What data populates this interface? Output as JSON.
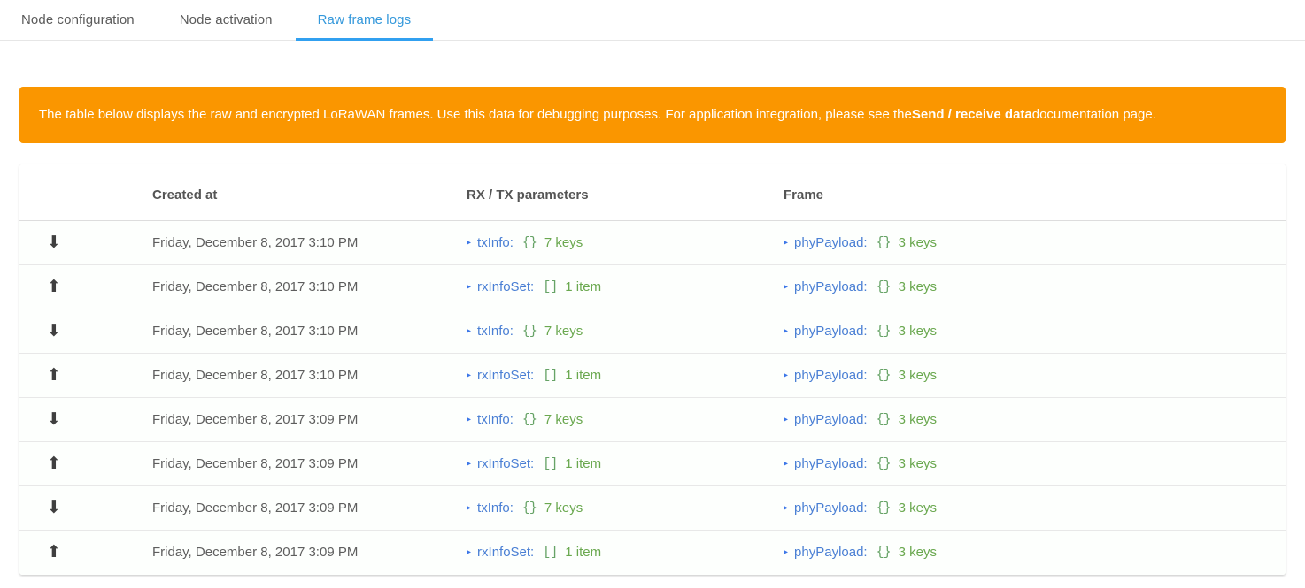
{
  "tabs": [
    {
      "label": "Node configuration",
      "active": false
    },
    {
      "label": "Node activation",
      "active": false
    },
    {
      "label": "Raw frame logs",
      "active": true
    }
  ],
  "alert": {
    "text_before": "The table below displays the raw and encrypted LoRaWAN frames. Use this data for debugging purposes. For application integration, please see the ",
    "link_label": "Send / receive data",
    "text_after": " documentation page.",
    "background": "#fa9600",
    "text_color": "#ffffff"
  },
  "table": {
    "columns": [
      {
        "key": "direction",
        "label": ""
      },
      {
        "key": "created_at",
        "label": "Created at"
      },
      {
        "key": "rxtx",
        "label": "RX / TX parameters"
      },
      {
        "key": "frame",
        "label": "Frame"
      }
    ],
    "rows": [
      {
        "direction_icon": "arrow-down-icon",
        "direction_glyph": "⬇",
        "created_at": "Friday, December 8, 2017 3:10 PM",
        "rxtx": {
          "caret": "▸",
          "key": "txInfo:",
          "brace": "{}",
          "count": "7 keys"
        },
        "frame": {
          "caret": "▸",
          "key": "phyPayload:",
          "brace": "{}",
          "count": "3 keys"
        }
      },
      {
        "direction_icon": "arrow-up-icon",
        "direction_glyph": "⬆",
        "created_at": "Friday, December 8, 2017 3:10 PM",
        "rxtx": {
          "caret": "▸",
          "key": "rxInfoSet:",
          "brace": "[]",
          "count": "1 item"
        },
        "frame": {
          "caret": "▸",
          "key": "phyPayload:",
          "brace": "{}",
          "count": "3 keys"
        }
      },
      {
        "direction_icon": "arrow-down-icon",
        "direction_glyph": "⬇",
        "created_at": "Friday, December 8, 2017 3:10 PM",
        "rxtx": {
          "caret": "▸",
          "key": "txInfo:",
          "brace": "{}",
          "count": "7 keys"
        },
        "frame": {
          "caret": "▸",
          "key": "phyPayload:",
          "brace": "{}",
          "count": "3 keys"
        }
      },
      {
        "direction_icon": "arrow-up-icon",
        "direction_glyph": "⬆",
        "created_at": "Friday, December 8, 2017 3:10 PM",
        "rxtx": {
          "caret": "▸",
          "key": "rxInfoSet:",
          "brace": "[]",
          "count": "1 item"
        },
        "frame": {
          "caret": "▸",
          "key": "phyPayload:",
          "brace": "{}",
          "count": "3 keys"
        }
      },
      {
        "direction_icon": "arrow-down-icon",
        "direction_glyph": "⬇",
        "created_at": "Friday, December 8, 2017 3:09 PM",
        "rxtx": {
          "caret": "▸",
          "key": "txInfo:",
          "brace": "{}",
          "count": "7 keys"
        },
        "frame": {
          "caret": "▸",
          "key": "phyPayload:",
          "brace": "{}",
          "count": "3 keys"
        }
      },
      {
        "direction_icon": "arrow-up-icon",
        "direction_glyph": "⬆",
        "created_at": "Friday, December 8, 2017 3:09 PM",
        "rxtx": {
          "caret": "▸",
          "key": "rxInfoSet:",
          "brace": "[]",
          "count": "1 item"
        },
        "frame": {
          "caret": "▸",
          "key": "phyPayload:",
          "brace": "{}",
          "count": "3 keys"
        }
      },
      {
        "direction_icon": "arrow-down-icon",
        "direction_glyph": "⬇",
        "created_at": "Friday, December 8, 2017 3:09 PM",
        "rxtx": {
          "caret": "▸",
          "key": "txInfo:",
          "brace": "{}",
          "count": "7 keys"
        },
        "frame": {
          "caret": "▸",
          "key": "phyPayload:",
          "brace": "{}",
          "count": "3 keys"
        }
      },
      {
        "direction_icon": "arrow-up-icon",
        "direction_glyph": "⬆",
        "created_at": "Friday, December 8, 2017 3:09 PM",
        "rxtx": {
          "caret": "▸",
          "key": "rxInfoSet:",
          "brace": "[]",
          "count": "1 item"
        },
        "frame": {
          "caret": "▸",
          "key": "phyPayload:",
          "brace": "{}",
          "count": "3 keys"
        }
      }
    ]
  },
  "colors": {
    "accent_blue": "#31a0f0",
    "alert_orange": "#fa9600",
    "json_key_blue": "#4a7fd4",
    "json_value_green": "#6aa84f",
    "text_gray": "#5e5e5e"
  }
}
